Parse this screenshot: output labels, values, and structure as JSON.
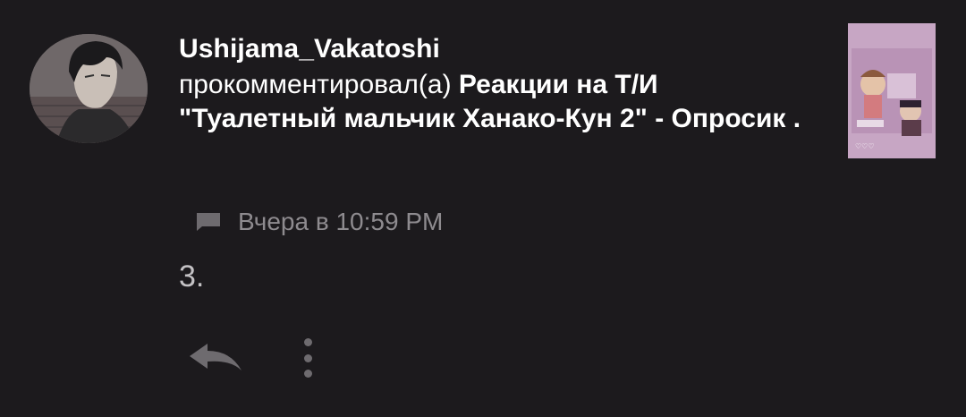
{
  "notification": {
    "username": "Ushijama_Vakatoshi",
    "action_text": "прокомментировал(а) ",
    "post_title": "Реакции на Т/И \"Туалетный мальчик Ханако-Кун 2\" - Опросик .",
    "timestamp": "Вчера в 10:59 PM",
    "comment_text": "3."
  },
  "icons": {
    "avatar": "user-avatar",
    "thumbnail": "post-thumbnail",
    "comment": "comment-icon",
    "reply": "reply-icon",
    "more": "more-vertical-icon"
  },
  "colors": {
    "background": "#1c1a1d",
    "primary_text": "#ffffff",
    "secondary_text": "#8e8b8f",
    "comment_text": "#c4c2c5",
    "icon": "#6e6b6f",
    "thumbnail_bg": "#c9a7c6"
  }
}
